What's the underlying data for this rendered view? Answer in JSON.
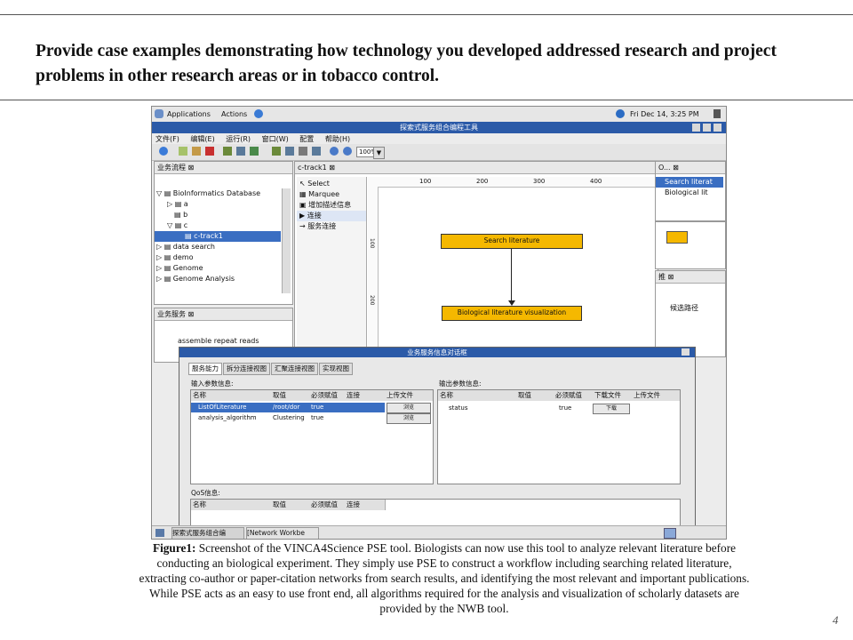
{
  "slide": {
    "heading": "Provide case examples demonstrating how technology you developed addressed research and project problems in other research areas or in tobacco control.",
    "caption_label": "Figure1:",
    "caption_text": " Screenshot of the VINCA4Science PSE tool. Biologists can now use this tool to analyze relevant literature before conducting an biological experiment. They simply use PSE to construct a workflow including searching related literature, extracting co-author or paper-citation networks from search results, and identifying the most relevant and important publications. While PSE acts as an easy to use front end, all algorithms required for the analysis and visualization of scholarly datasets are provided by the NWB tool.",
    "page_number": "4"
  },
  "desktop": {
    "applications": "Applications",
    "actions": "Actions",
    "clock": "Fri Dec 14,  3:25 PM"
  },
  "window": {
    "title": "探索式服务组合编程工具",
    "menu": [
      "文件(F)",
      "编辑(E)",
      "运行(R)",
      "窗口(W)",
      "配置",
      "帮助(H)"
    ],
    "zoom": "100%"
  },
  "workflow_panel": {
    "title": "业务流程",
    "items": [
      {
        "label": "BioInformatics Database",
        "depth": 0
      },
      {
        "label": "a",
        "depth": 1
      },
      {
        "label": "b",
        "depth": 1
      },
      {
        "label": "c",
        "depth": 1
      },
      {
        "label": "c-track1",
        "depth": 2,
        "selected": true
      },
      {
        "label": "data search",
        "depth": 0
      },
      {
        "label": "demo",
        "depth": 0
      },
      {
        "label": "Genome",
        "depth": 0
      },
      {
        "label": "Genome Analysis",
        "depth": 0
      }
    ]
  },
  "service_panel": {
    "title": "业务服务",
    "first_item": "assemble repeat reads"
  },
  "editor": {
    "tab": "c-track1",
    "palette": [
      "Select",
      "Marquee",
      "增加描述信息",
      "连接",
      "服务连接"
    ],
    "ruler": [
      "100",
      "200",
      "300",
      "400"
    ],
    "ruler_v": [
      "100",
      "200"
    ],
    "node1": "Search literature",
    "node2": "Biological literature visualization"
  },
  "right_panel": {
    "tab": "O...",
    "items": [
      "Search literat",
      "Biological lit"
    ],
    "second_title": "推",
    "second_item": "候选路径"
  },
  "dialog": {
    "title": "业务服务信息对话框",
    "tabs": [
      "服务能力",
      "拆分连接视图",
      "汇聚连接视图",
      "实现视图"
    ],
    "input_label": "输入参数信息:",
    "output_label": "输出参数信息:",
    "input_headers": [
      "名称",
      "取值",
      "必须赋值",
      "连接",
      "上传文件"
    ],
    "input_rows": [
      {
        "name": "ListOfLiterature",
        "value": "/root/dor",
        "required": "true",
        "btn": "浏览"
      },
      {
        "name": "analysis_algorithm",
        "value": "Clustering",
        "required": "true",
        "btn": "浏览"
      }
    ],
    "output_headers": [
      "名称",
      "取值",
      "必须赋值",
      "下载文件",
      "上传文件"
    ],
    "output_rows": [
      {
        "name": "status",
        "value": "",
        "required": "true",
        "btn": "下载"
      }
    ],
    "qos_label": "QoS信息:",
    "qos_headers": [
      "名称",
      "取值",
      "必须赋值",
      "连接"
    ]
  },
  "taskbar": {
    "items": [
      "探索式服务组合编",
      "[Network Workbe"
    ]
  }
}
